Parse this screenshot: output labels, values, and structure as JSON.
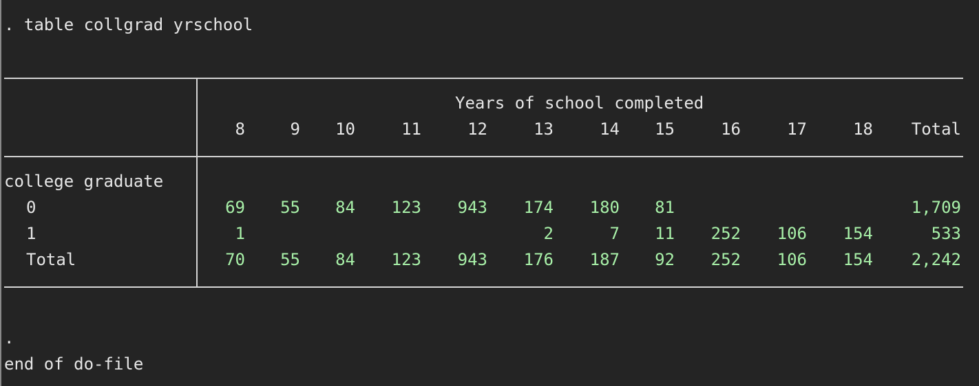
{
  "console": {
    "command": ". table collgrad yrschool",
    "prompt_dot": ".",
    "end_message": "end of do-file"
  },
  "table": {
    "col_var_label": "Years of school completed",
    "columns": [
      "8",
      "9",
      "10",
      "11",
      "12",
      "13",
      "14",
      "15",
      "16",
      "17",
      "18",
      "Total"
    ],
    "row_var_label": "college graduate",
    "rows": [
      {
        "label": "0",
        "values": [
          "69",
          "55",
          "84",
          "123",
          "943",
          "174",
          "180",
          "81",
          "",
          "",
          "",
          "1,709"
        ]
      },
      {
        "label": "1",
        "values": [
          "1",
          "",
          "",
          "",
          "",
          "2",
          "7",
          "11",
          "252",
          "106",
          "154",
          "533"
        ]
      },
      {
        "label": "Total",
        "values": [
          "70",
          "55",
          "84",
          "123",
          "943",
          "176",
          "187",
          "92",
          "252",
          "106",
          "154",
          "2,242"
        ]
      }
    ]
  },
  "colors": {
    "background": "#242424",
    "text": "#e6e6e6",
    "numbers": "#a8f0a8",
    "rules": "#d6d6d6"
  }
}
